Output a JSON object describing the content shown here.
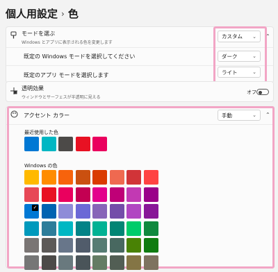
{
  "breadcrumb": {
    "parent": "個人用設定",
    "separator": "›",
    "current": "色"
  },
  "mode": {
    "title": "モードを選ぶ",
    "description": "Windows とアプリに表示される色を変更します",
    "value": "カスタム",
    "windows_mode": {
      "label": "既定の Windows モードを選択してください",
      "value": "ダーク"
    },
    "app_mode": {
      "label": "既定のアプリ モードを選択します",
      "value": "ライト"
    }
  },
  "transparency": {
    "title": "透明効果",
    "description": "ウィンドウとサーフェスが半透明に見える",
    "state": "オフ"
  },
  "accent": {
    "title": "アクセント カラー",
    "value": "手動",
    "recent_label": "最近使用した色",
    "recent_colors": [
      "#0078d4",
      "#00b7c3",
      "#4c4a48",
      "#e81123",
      "#ea005e"
    ],
    "windows_label": "Windows の色",
    "windows_colors": [
      [
        "#ffb900",
        "#ff8c00",
        "#f7630c",
        "#ca5010",
        "#da3b01",
        "#ef6950",
        "#d13438",
        "#ff4343"
      ],
      [
        "#e74856",
        "#e81123",
        "#ea005e",
        "#c30052",
        "#e3008c",
        "#bf0077",
        "#c239b3",
        "#9a0089"
      ],
      [
        "#0078d4",
        "#0063b1",
        "#8e8cd8",
        "#6b69d6",
        "#8764b8",
        "#744da9",
        "#b146c2",
        "#881798"
      ],
      [
        "#0099bc",
        "#2d7d9a",
        "#00b7c3",
        "#038387",
        "#00b294",
        "#018574",
        "#00cc6a",
        "#10893e"
      ],
      [
        "#7a7574",
        "#5d5a58",
        "#68768a",
        "#515c6b",
        "#567c73",
        "#486860",
        "#498205",
        "#107c10"
      ],
      [
        "#767676",
        "#4c4a48",
        "#69797e",
        "#4a5459",
        "#647c64",
        "#525e54",
        "#847545",
        "#7e735f"
      ]
    ]
  },
  "icons": {
    "chevron_down": "⌄",
    "chevron_up": "⌃",
    "check": "✓"
  }
}
